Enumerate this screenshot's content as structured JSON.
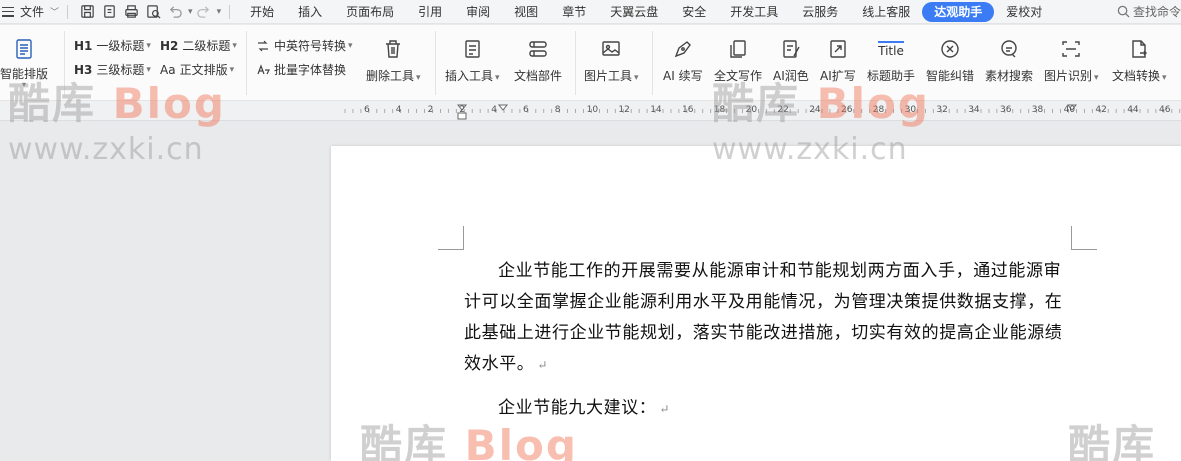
{
  "menubar": {
    "file_label": "文件",
    "tabs": [
      {
        "label": "开始",
        "active": false
      },
      {
        "label": "插入",
        "active": false
      },
      {
        "label": "页面布局",
        "active": false
      },
      {
        "label": "引用",
        "active": false
      },
      {
        "label": "审阅",
        "active": false
      },
      {
        "label": "视图",
        "active": false
      },
      {
        "label": "章节",
        "active": false
      },
      {
        "label": "天翼云盘",
        "active": false
      },
      {
        "label": "安全",
        "active": false
      },
      {
        "label": "开发工具",
        "active": false
      },
      {
        "label": "云服务",
        "active": false
      },
      {
        "label": "线上客服",
        "active": false
      },
      {
        "label": "达观助手",
        "active": true
      },
      {
        "label": "爱校对",
        "active": false
      }
    ],
    "search_label": "查找命令"
  },
  "toolbar": {
    "smart_layout": "智能排版",
    "h1": {
      "tag": "H1",
      "label": "一级标题"
    },
    "h2": {
      "tag": "H2",
      "label": "二级标题"
    },
    "h3": {
      "tag": "H3",
      "label": "三级标题"
    },
    "body": {
      "tag": "Aa",
      "label": "正文排版"
    },
    "punct_convert": "中英符号转换",
    "batch_font": "批量字体替换",
    "delete_tool": "删除工具",
    "insert_tool": "插入工具",
    "doc_parts": "文档部件",
    "image_tool": "图片工具",
    "ai_continue": "AI 续写",
    "full_write": "全文写作",
    "ai_polish": "AI润色",
    "ai_expand": "AI扩写",
    "title_helper": "标题助手",
    "smart_correct": "智能纠错",
    "material_search": "素材搜索",
    "image_recognize": "图片识别",
    "doc_convert": "文档转换",
    "title_icon_text": "Title"
  },
  "ruler": {
    "ticks": [
      "6",
      "4",
      "2",
      "2",
      "4",
      "6",
      "8",
      "10",
      "12",
      "14",
      "16",
      "18",
      "20",
      "22",
      "24",
      "26",
      "28",
      "30",
      "32",
      "34",
      "36",
      "38",
      "40",
      "42",
      "44",
      "46"
    ]
  },
  "document": {
    "paragraph1": "企业节能工作的开展需要从能源审计和节能规划两方面入手，通过能源审计可以全面掌握企业能源利用水平及用能情况，为管理决策提供数据支撑，在此基础上进行企业节能规划，落实节能改进措施，切实有效的提高企业能源绩效水平。",
    "paragraph2": "企业节能九大建议：",
    "para_mark": "↵"
  },
  "watermark": {
    "logo_cn": "酷库",
    "logo_en": "Blog",
    "url": "www.zxki.cn"
  },
  "colors": {
    "accent": "#3b7cf5"
  }
}
